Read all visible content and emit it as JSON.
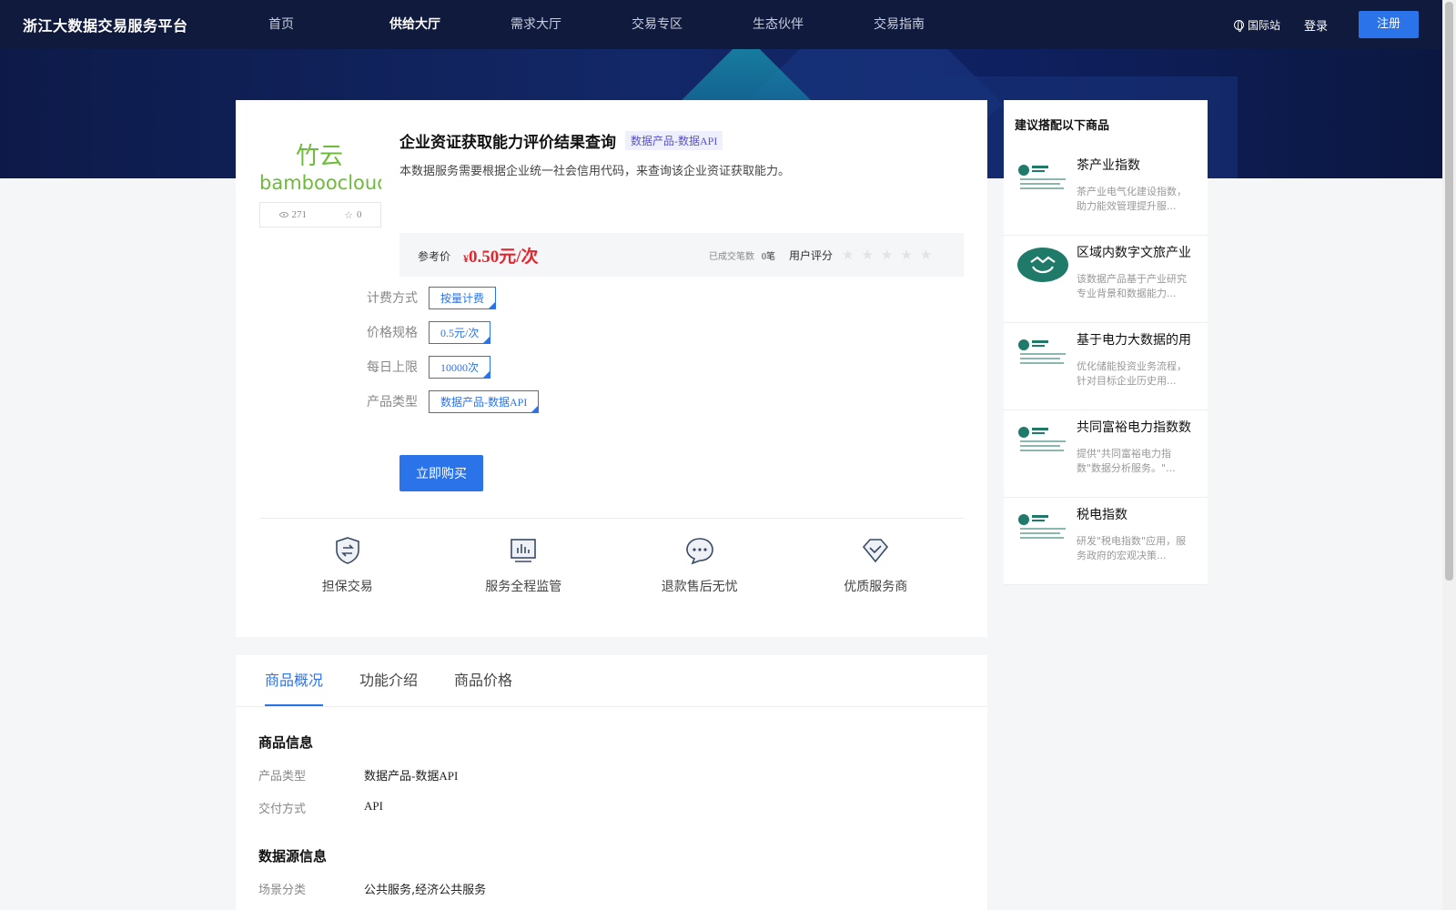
{
  "header": {
    "logo": "浙江大数据交易服务平台",
    "nav": [
      "首页",
      "供给大厅",
      "需求大厅",
      "交易专区",
      "生态伙伴",
      "交易指南"
    ],
    "active_nav": 1,
    "intl": "国际站",
    "login": "登录",
    "register": "注册"
  },
  "product": {
    "logo_text_cn": "竹云",
    "logo_text_en": "bamboocloud",
    "views": "271",
    "favorites": "0",
    "title": "企业资证获取能力评价结果查询",
    "tag": "数据产品-数据API",
    "description": "本数据服务需要根据企业统一社会信用代码，来查询该企业资证获取能力。",
    "price_label": "参考价",
    "price_symbol": "¥",
    "price": "0.50元/次",
    "deal_count_label": "已成交笔数",
    "deal_count": "0笔",
    "rating_label": "用户评分",
    "rating_stars": 0,
    "specs": [
      {
        "label": "计费方式",
        "value": "按量计费"
      },
      {
        "label": "价格规格",
        "value": "0.5元/次"
      },
      {
        "label": "每日上限",
        "value": "10000次"
      },
      {
        "label": "产品类型",
        "value": "数据产品-数据API"
      }
    ],
    "buy_label": "立即购买",
    "features": [
      {
        "label": "担保交易",
        "icon": "shield-exchange-icon"
      },
      {
        "label": "服务全程监管",
        "icon": "monitor-chart-icon"
      },
      {
        "label": "退款售后无忧",
        "icon": "chat-bubble-icon"
      },
      {
        "label": "优质服务商",
        "icon": "diamond-check-icon"
      }
    ]
  },
  "side": {
    "title": "建议搭配以下商品",
    "items": [
      {
        "name": "茶产业指数",
        "desc": "茶产业电气化建设指数，助力能效管理提升服...",
        "thumb": "state-grid-logo"
      },
      {
        "name": "区域内数字文旅产业",
        "desc": "该数据产品基于产业研究专业背景和数据能力...",
        "thumb": "green-round-logo"
      },
      {
        "name": "基于电力大数据的用",
        "desc": "优化储能投资业务流程，针对目标企业历史用...",
        "thumb": "state-grid-logo"
      },
      {
        "name": "共同富裕电力指数数",
        "desc": "提供\"共同富裕电力指数\"数据分析服务。\"...",
        "thumb": "state-grid-logo"
      },
      {
        "name": "税电指数",
        "desc": "研发\"税电指数\"应用，服务政府的宏观决策...",
        "thumb": "state-grid-logo"
      }
    ]
  },
  "details": {
    "tabs": [
      "商品概况",
      "功能介绍",
      "商品价格"
    ],
    "active_tab": 0,
    "section1_title": "商品信息",
    "info1": [
      {
        "label": "产品类型",
        "value": "数据产品-数据API"
      },
      {
        "label": "交付方式",
        "value": "API"
      }
    ],
    "section2_title": "数据源信息",
    "info2": [
      {
        "label": "场景分类",
        "value": "公共服务,经济公共服务"
      }
    ]
  },
  "colors": {
    "accent": "#2b73e8",
    "price": "#e3262e",
    "header_bg": "#0f1a3d"
  }
}
